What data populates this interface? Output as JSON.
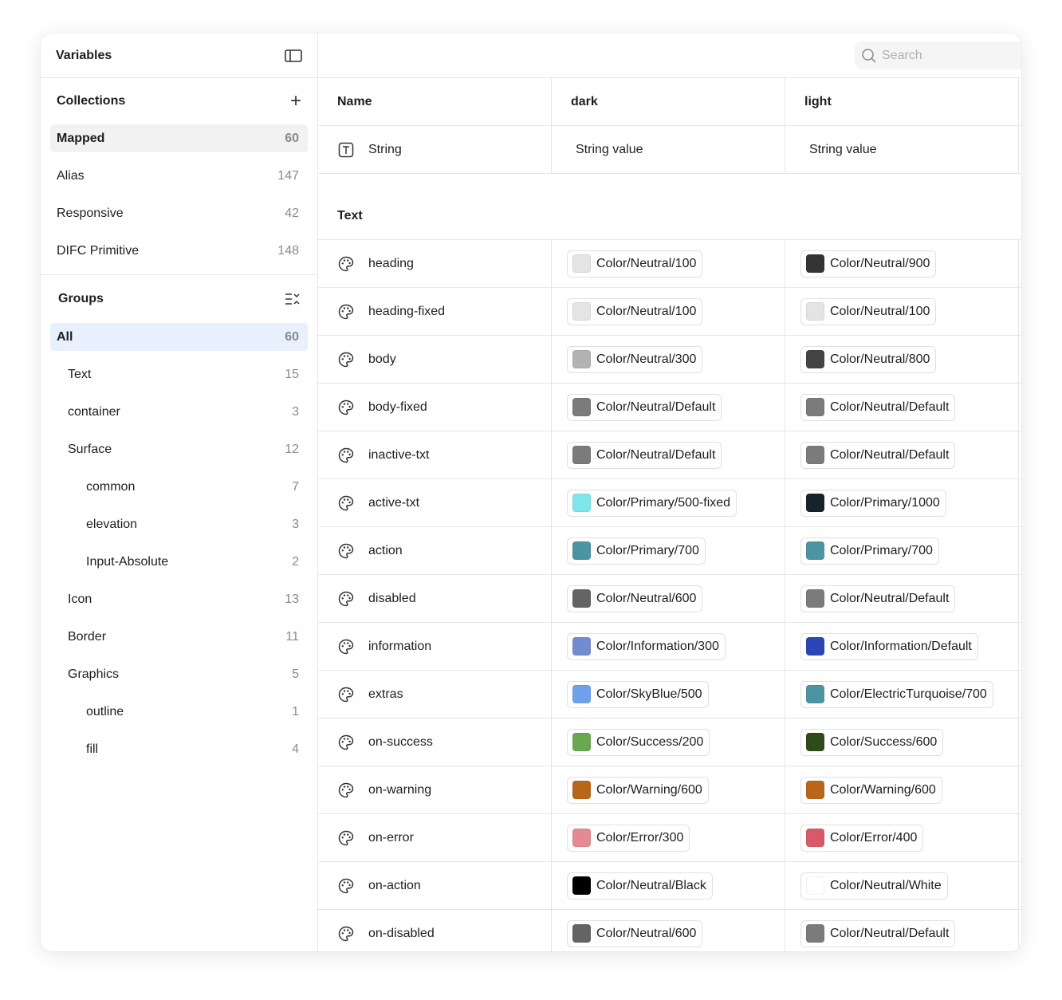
{
  "sidebar": {
    "title": "Variables",
    "collections_title": "Collections",
    "collections": [
      {
        "label": "Mapped",
        "count": "60"
      },
      {
        "label": "Alias",
        "count": "147"
      },
      {
        "label": "Responsive",
        "count": "42"
      },
      {
        "label": "DIFC Primitive",
        "count": "148"
      }
    ],
    "groups_title": "Groups",
    "groups": [
      {
        "label": "All",
        "count": "60"
      },
      {
        "label": "Text",
        "count": "15"
      },
      {
        "label": "container",
        "count": "3"
      },
      {
        "label": "Surface",
        "count": "12"
      },
      {
        "label": "common",
        "count": "7"
      },
      {
        "label": "elevation",
        "count": "3"
      },
      {
        "label": "Input-Absolute",
        "count": "2"
      },
      {
        "label": "Icon",
        "count": "13"
      },
      {
        "label": "Border",
        "count": "11"
      },
      {
        "label": "Graphics",
        "count": "5"
      },
      {
        "label": "outline",
        "count": "1"
      },
      {
        "label": "fill",
        "count": "4"
      }
    ]
  },
  "search": {
    "placeholder": "Search"
  },
  "table": {
    "headers": {
      "name": "Name",
      "dark": "dark",
      "light": "light"
    },
    "string_row": {
      "name": "String",
      "dark": "String value",
      "light": "String value"
    },
    "group_title": "Text",
    "rows": [
      {
        "name": "heading",
        "dark": {
          "label": "Color/Neutral/100",
          "color": "#e4e4e4"
        },
        "light": {
          "label": "Color/Neutral/900",
          "color": "#333333"
        }
      },
      {
        "name": "heading-fixed",
        "dark": {
          "label": "Color/Neutral/100",
          "color": "#e4e4e4"
        },
        "light": {
          "label": "Color/Neutral/100",
          "color": "#e4e4e4"
        }
      },
      {
        "name": "body",
        "dark": {
          "label": "Color/Neutral/300",
          "color": "#b3b3b3"
        },
        "light": {
          "label": "Color/Neutral/800",
          "color": "#444444"
        }
      },
      {
        "name": "body-fixed",
        "dark": {
          "label": "Color/Neutral/Default",
          "color": "#7b7b7b"
        },
        "light": {
          "label": "Color/Neutral/Default",
          "color": "#7b7b7b"
        }
      },
      {
        "name": "inactive-txt",
        "dark": {
          "label": "Color/Neutral/Default",
          "color": "#7b7b7b"
        },
        "light": {
          "label": "Color/Neutral/Default",
          "color": "#7b7b7b"
        }
      },
      {
        "name": "active-txt",
        "dark": {
          "label": "Color/Primary/500-fixed",
          "color": "#7ee5e8"
        },
        "light": {
          "label": "Color/Primary/1000",
          "color": "#17232a"
        }
      },
      {
        "name": "action",
        "dark": {
          "label": "Color/Primary/700",
          "color": "#4b95a3"
        },
        "light": {
          "label": "Color/Primary/700",
          "color": "#4b95a3"
        }
      },
      {
        "name": "disabled",
        "dark": {
          "label": "Color/Neutral/600",
          "color": "#646464"
        },
        "light": {
          "label": "Color/Neutral/Default",
          "color": "#7b7b7b"
        }
      },
      {
        "name": "information",
        "dark": {
          "label": "Color/Information/300",
          "color": "#738ccf"
        },
        "light": {
          "label": "Color/Information/Default",
          "color": "#2a47b5"
        }
      },
      {
        "name": "extras",
        "dark": {
          "label": "Color/SkyBlue/500",
          "color": "#6ea1e8"
        },
        "light": {
          "label": "Color/ElectricTurquoise/700",
          "color": "#4b95a3"
        }
      },
      {
        "name": "on-success",
        "dark": {
          "label": "Color/Success/200",
          "color": "#6aa84f"
        },
        "light": {
          "label": "Color/Success/600",
          "color": "#2d4c1a"
        }
      },
      {
        "name": "on-warning",
        "dark": {
          "label": "Color/Warning/600",
          "color": "#b8671a"
        },
        "light": {
          "label": "Color/Warning/600",
          "color": "#b8671a"
        }
      },
      {
        "name": "on-error",
        "dark": {
          "label": "Color/Error/300",
          "color": "#e48a93"
        },
        "light": {
          "label": "Color/Error/400",
          "color": "#d85a68"
        }
      },
      {
        "name": "on-action",
        "dark": {
          "label": "Color/Neutral/Black",
          "color": "#000000"
        },
        "light": {
          "label": "Color/Neutral/White",
          "color": "#ffffff"
        }
      },
      {
        "name": "on-disabled",
        "dark": {
          "label": "Color/Neutral/600",
          "color": "#646464"
        },
        "light": {
          "label": "Color/Neutral/Default",
          "color": "#7b7b7b"
        }
      }
    ]
  }
}
